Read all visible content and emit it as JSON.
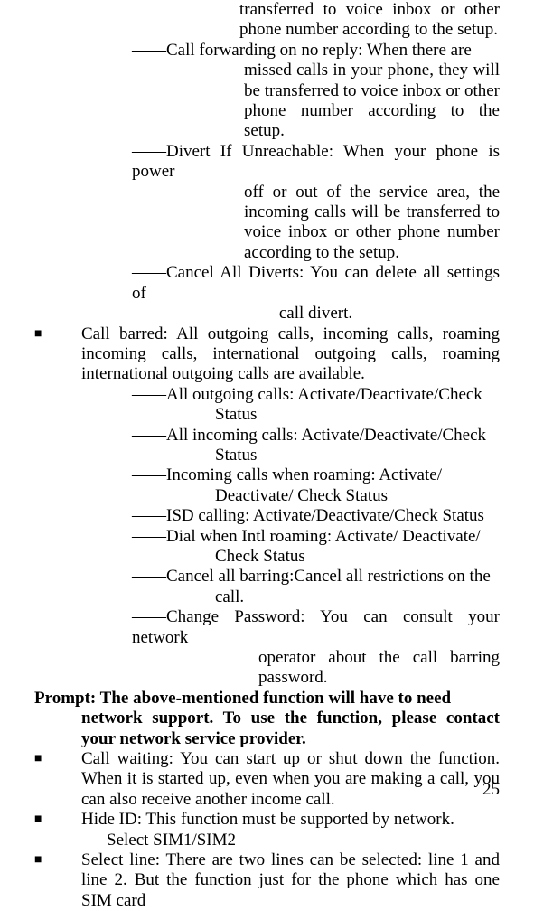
{
  "top_fragment": {
    "l1": "transferred to voice inbox or other phone number according to the setup."
  },
  "sect1": {
    "i1_h": "――Call forwarding on no reply: When there are",
    "i1_c": "missed calls in your phone, they will be transferred to voice inbox or other phone number according to the setup.",
    "i2_h": "――Divert If Unreachable: When your phone is power",
    "i2_c": "off or out of the service area, the incoming calls will be transferred to voice inbox or other phone number according to the setup.",
    "i3_h": "――Cancel All Diverts: You can delete all settings of",
    "i3_c": "call divert."
  },
  "bullet_callbarred": {
    "p1": "Call barred: All outgoing calls, incoming calls, roaming incoming calls, international outgoing calls, roaming international outgoing calls are available."
  },
  "sect2": {
    "i1_h": "――All outgoing calls: Activate/Deactivate/Check",
    "i1_c": "Status",
    "i2_h": "――All incoming calls: Activate/Deactivate/Check",
    "i2_c": "Status",
    "i3_h": "――Incoming calls when roaming: Activate/",
    "i3_c": "Deactivate/ Check Status",
    "i4_h": "――ISD calling: Activate/Deactivate/Check Status",
    "i5_h": "――Dial when Intl roaming: Activate/ Deactivate/",
    "i5_c": "Check Status",
    "i6_h": "――Cancel all barring:Cancel all restrictions on the",
    "i6_c": "call.",
    "i7_h": "――Change Password: You can consult your network",
    "i7_c": "operator about the call barring password."
  },
  "prompt": {
    "l1": "Prompt: The above-mentioned function will have to need",
    "l2": "network support. To use the function, please contact your network service provider."
  },
  "bullet_waiting": "Call waiting: You can start up or shut down the function. When it is started up, even when you are making a call, you can also receive another income call.",
  "bullet_hide": "Hide ID: This function must be supported by network.",
  "hide_sub": "Select SIM1/SIM2",
  "bullet_select": "Select line: There are two lines can be selected: line 1 and line 2. But the function just for the phone which has one SIM card",
  "page_number": "25"
}
